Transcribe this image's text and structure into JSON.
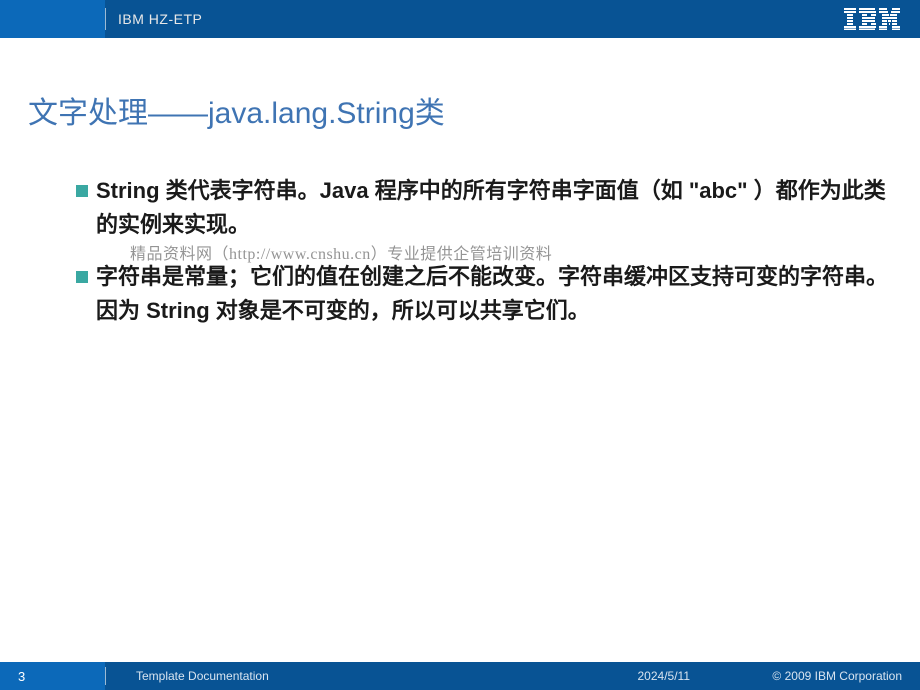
{
  "header": {
    "brand": "IBM HZ-ETP"
  },
  "title": {
    "full": "文字处理——java.lang.String类"
  },
  "bullets": [
    "String 类代表字符串。Java 程序中的所有字符串字面值（如 \"abc\" ）都作为此类的实例来实现。",
    "字符串是常量；它们的值在创建之后不能改变。字符串缓冲区支持可变的字符串。因为 String 对象是不可变的，所以可以共享它们。"
  ],
  "watermark": "精品资料网（http://www.cnshu.cn）专业提供企管培训资料",
  "footer": {
    "page": "3",
    "doc": "Template Documentation",
    "date": "2024/5/11",
    "copyright": "© 2009 IBM Corporation"
  }
}
